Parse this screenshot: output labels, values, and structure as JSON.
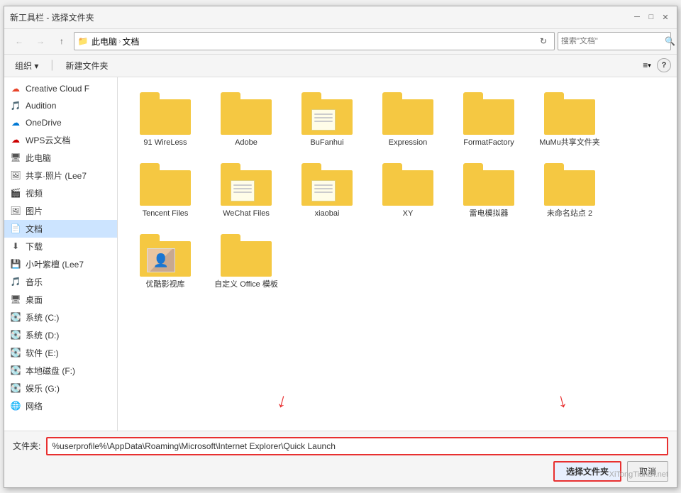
{
  "window": {
    "title": "新工具栏 - 选择文件夹",
    "close_btn": "✕",
    "minimize_btn": "─",
    "maximize_btn": "□"
  },
  "toolbar": {
    "back_btn": "←",
    "forward_btn": "→",
    "up_btn": "↑",
    "address_icon": "📁",
    "address_parts": [
      "此电脑",
      "文档"
    ],
    "address_sep": "›",
    "refresh_label": "↻",
    "search_placeholder": "搜索\"文档\""
  },
  "action_bar": {
    "organize_label": "组织 ▾",
    "new_folder_label": "新建文件夹",
    "view_label": "≡",
    "help_label": "?"
  },
  "sidebar": {
    "items": [
      {
        "id": "creative-cloud",
        "label": "Creative Cloud F",
        "icon": "☁",
        "icon_color": "#e8442a"
      },
      {
        "id": "audition",
        "label": "Audition",
        "icon": "🎵",
        "icon_color": "#f5c842"
      },
      {
        "id": "onedrive",
        "label": "OneDrive",
        "icon": "☁",
        "icon_color": "#0078d4"
      },
      {
        "id": "wps",
        "label": "WPS云文档",
        "icon": "☁",
        "icon_color": "#c00"
      },
      {
        "id": "this-pc",
        "label": "此电脑",
        "icon": "🖥",
        "icon_color": "#555"
      },
      {
        "id": "shared-photos",
        "label": "共享·照片 (Lee7",
        "icon": "🖼",
        "icon_color": "#555"
      },
      {
        "id": "videos",
        "label": "视频",
        "icon": "🎬",
        "icon_color": "#555"
      },
      {
        "id": "pictures",
        "label": "图片",
        "icon": "🖼",
        "icon_color": "#555"
      },
      {
        "id": "documents",
        "label": "文档",
        "icon": "📄",
        "icon_color": "#555",
        "selected": true
      },
      {
        "id": "downloads",
        "label": "下载",
        "icon": "⬇",
        "icon_color": "#555"
      },
      {
        "id": "xiaoyezijin",
        "label": "小叶紫檀 (Lee7",
        "icon": "💾",
        "icon_color": "#555"
      },
      {
        "id": "music",
        "label": "音乐",
        "icon": "🎵",
        "icon_color": "#555"
      },
      {
        "id": "desktop",
        "label": "桌面",
        "icon": "🖥",
        "icon_color": "#555"
      },
      {
        "id": "sys-c",
        "label": "系统 (C:)",
        "icon": "💽",
        "icon_color": "#555"
      },
      {
        "id": "sys-d",
        "label": "系统 (D:)",
        "icon": "💽",
        "icon_color": "#555"
      },
      {
        "id": "soft-e",
        "label": "软件 (E:)",
        "icon": "💽",
        "icon_color": "#555"
      },
      {
        "id": "local-f",
        "label": "本地磁盘 (F:)",
        "icon": "💽",
        "icon_color": "#555"
      },
      {
        "id": "entertain-g",
        "label": "娱乐 (G:)",
        "icon": "💽",
        "icon_color": "#555"
      },
      {
        "id": "network",
        "label": "网络",
        "icon": "🌐",
        "icon_color": "#555"
      }
    ]
  },
  "folders": {
    "row1": [
      {
        "name": "91 WireLess",
        "type": "folder"
      },
      {
        "name": "Adobe",
        "type": "folder"
      },
      {
        "name": "BuFanhui",
        "type": "folder-doc"
      },
      {
        "name": "Expression",
        "type": "folder"
      },
      {
        "name": "FormatFactory",
        "type": "folder"
      },
      {
        "name": "MuMu共享文件夹",
        "type": "folder"
      },
      {
        "name": "Tencent Files",
        "type": "folder"
      }
    ],
    "row2": [
      {
        "name": "WeChat Files",
        "type": "folder-doc"
      },
      {
        "name": "xiaobai",
        "type": "folder-doc"
      },
      {
        "name": "XY",
        "type": "folder"
      },
      {
        "name": "雷电模拟器",
        "type": "folder"
      },
      {
        "name": "未命名站点 2",
        "type": "folder"
      },
      {
        "name": "优酷影视库",
        "type": "folder-photo"
      },
      {
        "name": "自定义 Office 模板",
        "type": "folder"
      }
    ]
  },
  "bottom": {
    "file_label": "文件夹:",
    "file_value": "%userprofile%\\AppData\\Roaming\\Microsoft\\Internet Explorer\\Quick Launch",
    "select_btn": "选择文件夹",
    "cancel_btn": "取消"
  },
  "watermark": {
    "text": "XiTongTianDi.net"
  }
}
